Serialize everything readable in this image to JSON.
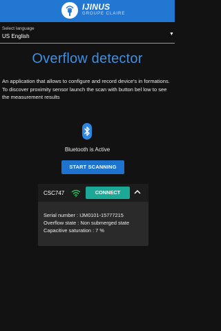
{
  "header": {
    "logo_title": "IJINUS",
    "logo_subtitle": "GROUPE CLAIRE"
  },
  "language": {
    "label": "Select language",
    "value": "US English"
  },
  "page": {
    "title": "Overflow detector",
    "description_1": "An application that allows to configure and record device's in formations.",
    "description_2": "To discover proximity sensor launch the scan with button bel low to see the measurement results"
  },
  "bluetooth": {
    "status": "Bluetooth is Active",
    "scan_label": "START SCANNING"
  },
  "device": {
    "name": "CSC747",
    "connect_label": "CONNECT",
    "serial": "Serial number : IJM0101-15777215",
    "overflow_state": "Overflow state : Non submerged state",
    "capacitive": "Capacitive saturation : 7 %"
  },
  "colors": {
    "header_blue": "#2277d3",
    "title_blue": "#3f8fe3",
    "connect_green": "#1ba897"
  }
}
